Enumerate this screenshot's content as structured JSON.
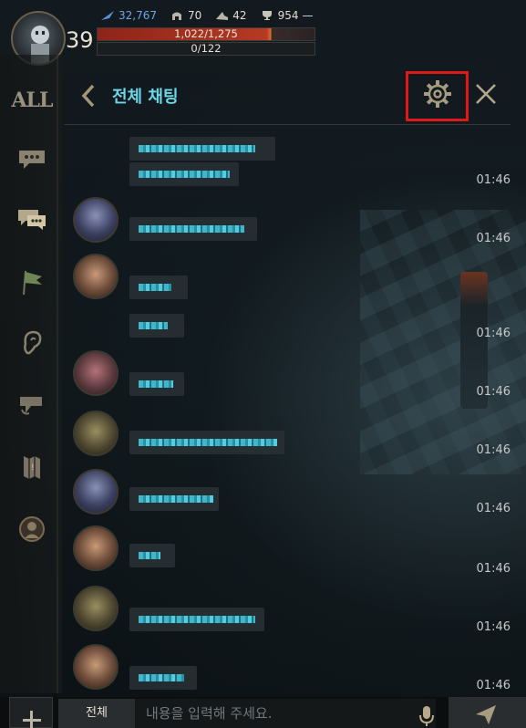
{
  "hud": {
    "level": "39",
    "stats": {
      "gems": "32,767",
      "helm": "70",
      "boots": "42",
      "trophy": "954"
    },
    "hp_text": "1,022/1,275",
    "hp_fraction": 0.8,
    "xp_text": "0/122"
  },
  "sidebar": {
    "all_label": "ALL",
    "items": [
      "all",
      "chat-bubble",
      "party-chat",
      "guild-flag",
      "whisper-ear",
      "social",
      "map-scroll",
      "friends-portrait"
    ]
  },
  "chat": {
    "title": "전체 채팅",
    "messages": [
      {
        "time": "01:46"
      },
      {
        "time": "01:46"
      },
      {
        "time": "01:46"
      },
      {
        "time": "01:46"
      },
      {
        "time": "01:46"
      },
      {
        "time": "01:46"
      },
      {
        "time": "01:46"
      },
      {
        "time": "01:46"
      },
      {
        "time": "01:46"
      }
    ]
  },
  "input": {
    "channel": "전체",
    "placeholder": "내용을 입력해 주세요."
  },
  "colors": {
    "accent": "#6bd8e8",
    "highlight": "#e01818",
    "hp": "#b53a22"
  }
}
